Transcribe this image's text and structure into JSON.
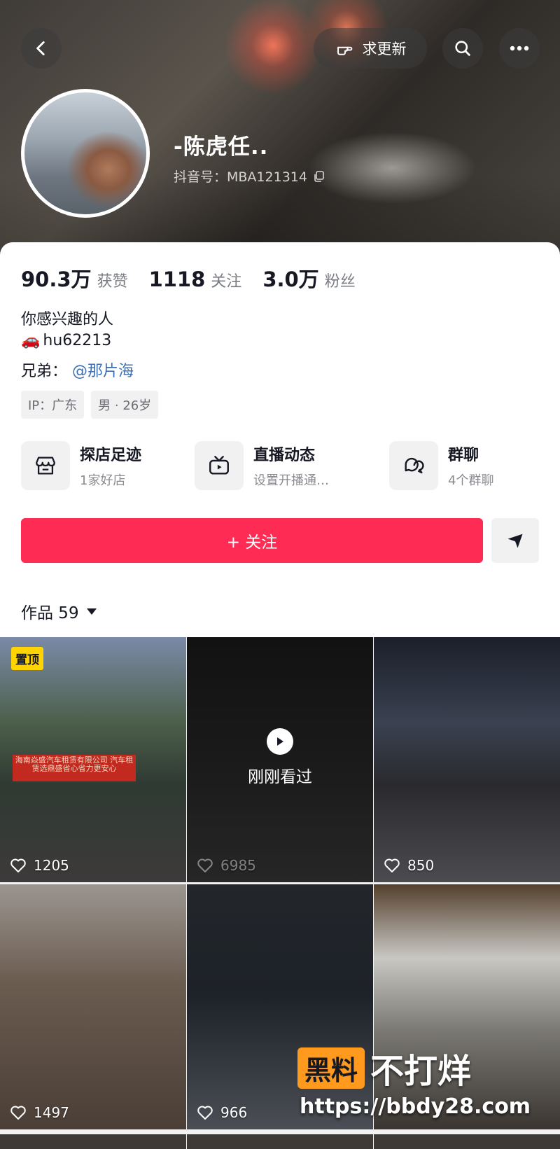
{
  "header": {
    "request_update_label": "求更新"
  },
  "profile": {
    "name": "-陈虎任..",
    "douyin_id": "抖音号：MBA121314"
  },
  "stats": [
    {
      "value": "90.3万",
      "label": "获赞"
    },
    {
      "value": "1118",
      "label": "关注"
    },
    {
      "value": "3.0万",
      "label": "粉丝"
    }
  ],
  "bio": {
    "line1": "你感兴趣的人",
    "line2_emoji": "🚗",
    "line2_text": "hu62213",
    "line3_prefix": "兄弟：",
    "line3_mention": "@那片海"
  },
  "tags": [
    "IP：广东",
    "男 · 26岁"
  ],
  "features": [
    {
      "title": "探店足迹",
      "subtitle": "1家好店",
      "icon": "store-icon"
    },
    {
      "title": "直播动态",
      "subtitle": "设置开播通…",
      "icon": "tv-icon"
    },
    {
      "title": "群聊",
      "subtitle": "4个群聊",
      "icon": "chat-bubbles-icon"
    }
  ],
  "follow_label": "+ 关注",
  "works": {
    "label": "作品 59"
  },
  "videos": [
    {
      "likes": "1205",
      "pinned_label": "置顶",
      "banner_text": "海南焱盛汽车租赁有限公司 汽车租赁选鼎盛省心省力更安心"
    },
    {
      "likes": "6985",
      "watched_label": "刚刚看过"
    },
    {
      "likes": "850"
    },
    {
      "likes": "1497"
    },
    {
      "likes": "966"
    },
    {
      "likes": ""
    }
  ],
  "watermark": {
    "box_text": "黑料",
    "text": "不打烊",
    "url": "https://bbdy28.com"
  },
  "colors": {
    "accent": "#fe2c55",
    "link": "#3b6fb6",
    "pin": "#ffd400"
  }
}
